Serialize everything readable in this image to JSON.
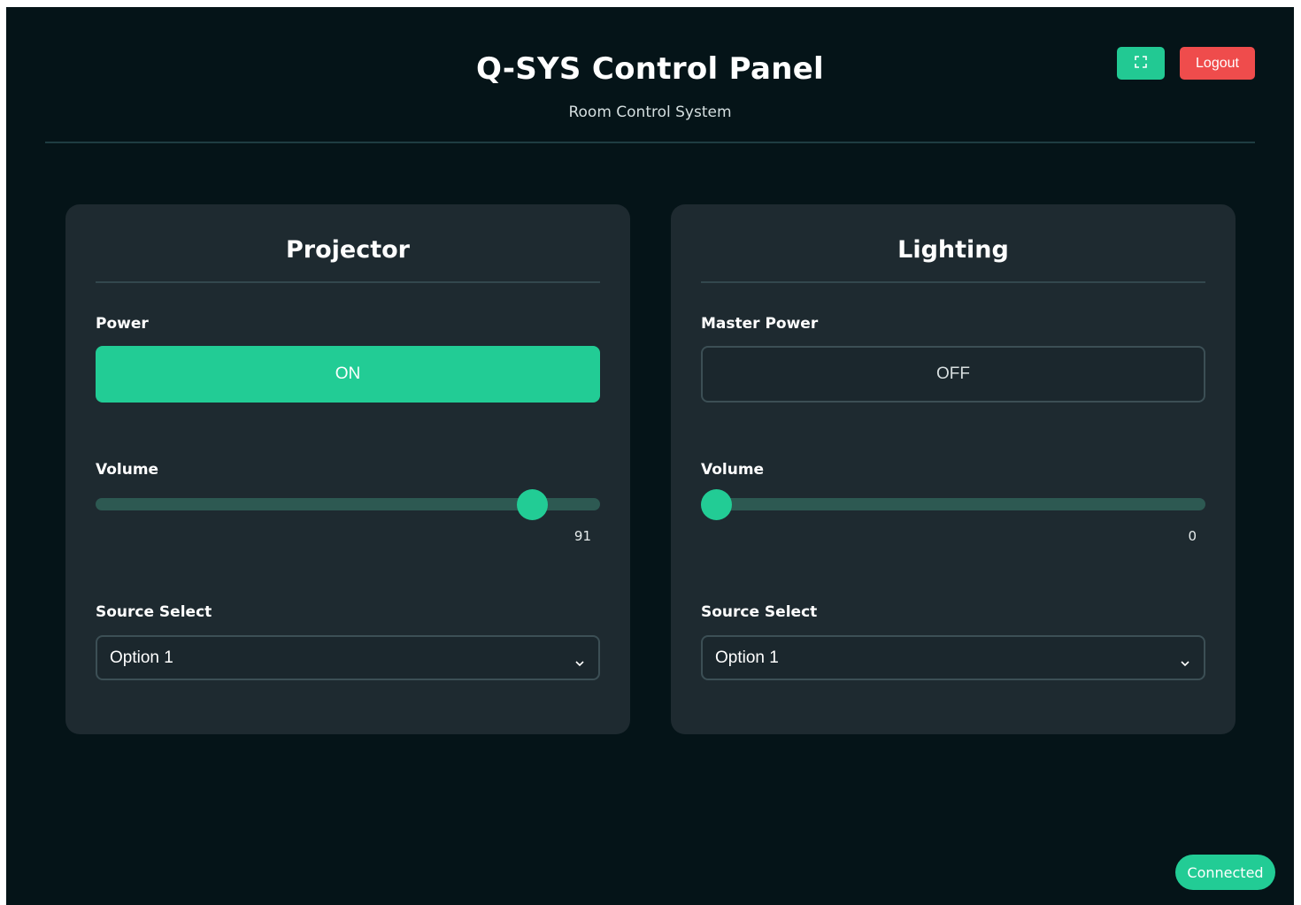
{
  "header": {
    "title": "Q-SYS Control Panel",
    "subtitle": "Room Control System",
    "fullscreen_icon": "fullscreen-icon",
    "logout_label": "Logout"
  },
  "colors": {
    "accent": "#22cc95",
    "danger": "#ef4c4c",
    "background": "#051418",
    "card": "#1e2a30"
  },
  "projector": {
    "title": "Projector",
    "power_label": "Power",
    "power_state": "ON",
    "volume_label": "Volume",
    "volume_value": "91",
    "volume_fraction": 0.89,
    "source_label": "Source Select",
    "source_value": "Option 1"
  },
  "lighting": {
    "title": "Lighting",
    "power_label": "Master Power",
    "power_state": "OFF",
    "volume_label": "Volume",
    "volume_value": "0",
    "volume_fraction": 0.0,
    "source_label": "Source Select",
    "source_value": "Option 1"
  },
  "status": {
    "connection": "Connected"
  }
}
